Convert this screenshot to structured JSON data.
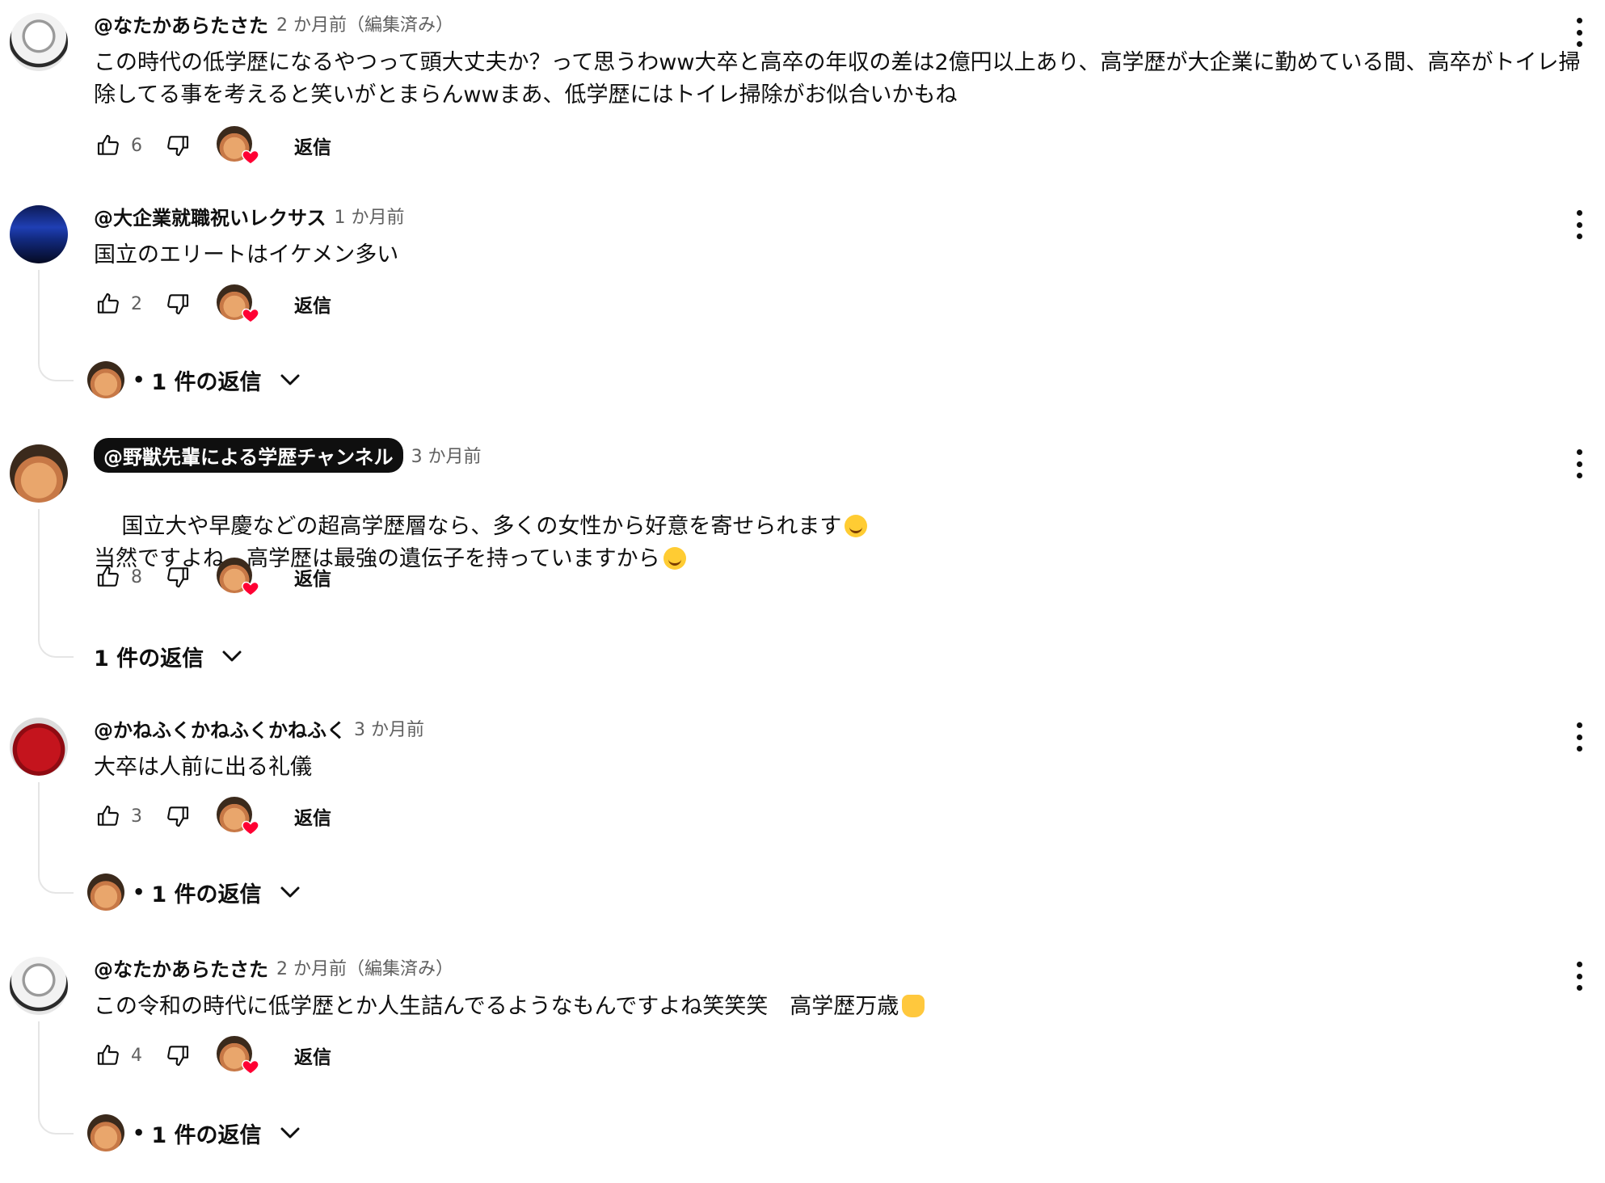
{
  "common": {
    "reply_label": "返信",
    "replies_label": "1 件の返信"
  },
  "comments": [
    {
      "author": "@なたかあらたさた",
      "time": "2 か月前（編集済み）",
      "text": "この時代の低学歴になるやつって頭大丈夫か？って思うわww大卒と高卒の年収の差は2億円以上あり、高学歴が大企業に勤めている間、高卒がトイレ掃除してる事を考えると笑いがとまらんwwまあ、低学歴にはトイレ掃除がお似合いかもね",
      "likes": "6"
    },
    {
      "author": "@大企業就職祝いレクサス",
      "time": "1 か月前",
      "text": "国立のエリートはイケメン多い",
      "likes": "2"
    },
    {
      "author": "@野獣先輩による学歴チャンネル",
      "time": "3 か月前",
      "text_line1": "国立大や早慶などの超高学歴層なら、多くの女性から好意を寄せられます",
      "text_line2": "当然ですよね。高学歴は最強の遺伝子を持っていますから",
      "likes": "8"
    },
    {
      "author": "@かねふくかねふくかねふく",
      "time": "3 か月前",
      "text": "大卒は人前に出る礼儀",
      "likes": "3"
    },
    {
      "author": "@なたかあらたさた",
      "time": "2 か月前（編集済み）",
      "text": "この令和の時代に低学歴とか人生詰んでるようなもんですよね笑笑笑　高学歴万歳",
      "likes": "4"
    }
  ],
  "colors": {
    "heart": "#ff0033",
    "text": "#0f0f0f",
    "meta": "#606060",
    "thread_line": "#e5e5e5"
  },
  "icons": [
    "like-icon",
    "dislike-icon",
    "heart-icon",
    "more-vert-icon",
    "chevron-down-icon"
  ]
}
